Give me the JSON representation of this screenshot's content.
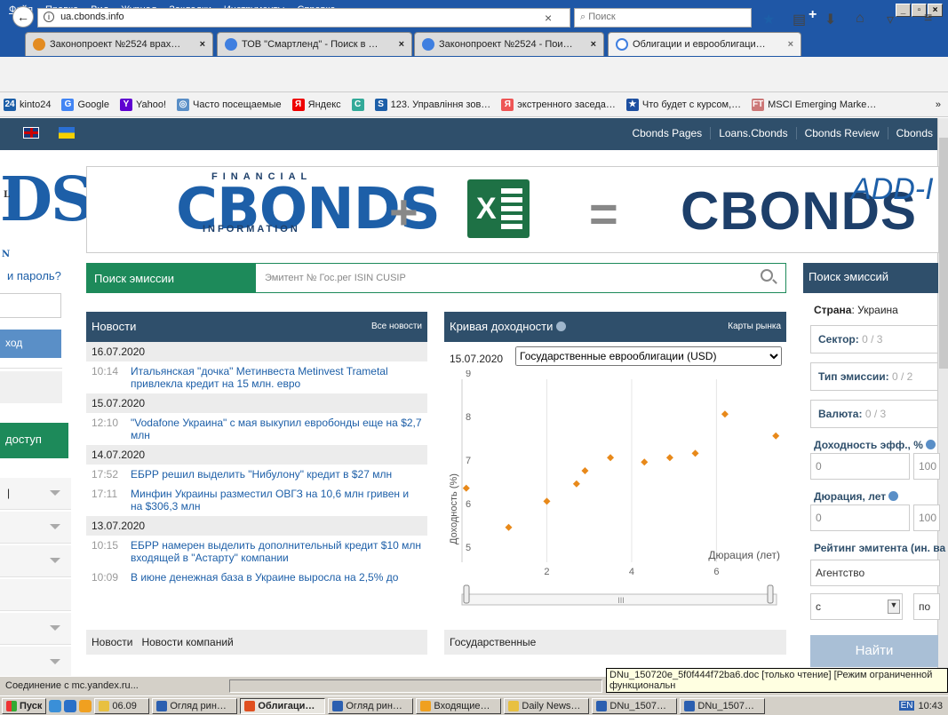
{
  "browser": {
    "menu": [
      "Файл",
      "Правка",
      "Вид",
      "Журнал",
      "Закладки",
      "Инструменты",
      "Справка"
    ],
    "tabs": [
      {
        "label": "Законопроект №2524 врах…",
        "close": "×",
        "color": "#e38b20"
      },
      {
        "label": "ТОВ \"Смартленд\" - Поиск в …",
        "close": "×",
        "color": "#3f7fe0"
      },
      {
        "label": "Законопроект №2524 - Пои…",
        "close": "×",
        "color": "#3f7fe0"
      },
      {
        "label": "Облигации и еврооблигаци…",
        "close": "×",
        "color": "#3f7fe0"
      }
    ],
    "new_tab": "+",
    "url": "ua.cbonds.info",
    "url_clear": "×",
    "search_placeholder": "Поиск",
    "bookmarks": [
      {
        "label": "kinto24",
        "icon": "24",
        "color": "#1d5fa8"
      },
      {
        "label": "Google",
        "icon": "G",
        "color": "#4285f4"
      },
      {
        "label": "Yahoo!",
        "icon": "Y",
        "color": "#5f01d1"
      },
      {
        "label": "Часто посещаемые",
        "icon": "◎",
        "color": "#5a8fc7"
      },
      {
        "label": "Яндекс",
        "icon": "Я",
        "color": "#e00"
      },
      {
        "label": "",
        "icon": "C",
        "color": "#3a9"
      },
      {
        "label": "123. Управління зов…",
        "icon": "S",
        "color": "#1d5fa8"
      },
      {
        "label": "экстренного заседа…",
        "icon": "Я",
        "color": "#e55"
      },
      {
        "label": "Что будет с курсом,…",
        "icon": "★",
        "color": "#1d4fa0"
      },
      {
        "label": "MSCI Emerging Marke…",
        "icon": "FT",
        "color": "#c77"
      }
    ],
    "bookmarks_more": "»"
  },
  "site": {
    "top_links": [
      "Cbonds Pages",
      "Loans.Cbonds",
      "Cbonds Review",
      "Cbonds"
    ],
    "left": {
      "logo": "DS",
      "logo_top": "L",
      "logo_bottom": "N",
      "forgot": "и пароль?",
      "login_btn": "ход",
      "access_btn": "доступ"
    },
    "banner": {
      "logo1": "CBONDS",
      "financial": "FINANCIAL",
      "information": "INFORMATION",
      "plus": "+",
      "excel": "X",
      "equals": "=",
      "logo2": "CBONDS",
      "addin": "ADD-I"
    },
    "search": {
      "label": "Поиск эмиссии",
      "placeholder": "Эмитент № Гос.рег ISIN CUSIP"
    },
    "news": {
      "title": "Новости",
      "all": "Все новости",
      "groups": [
        {
          "date": "16.07.2020",
          "items": [
            {
              "time": "10:14",
              "text": "Итальянская \"дочка\" Метинвеста Metinvest Trametal привлекла кредит на 15 млн. евро"
            }
          ]
        },
        {
          "date": "15.07.2020",
          "items": [
            {
              "time": "12:10",
              "text": "\"Vodafone Украина\" с мая выкупил евробонды еще на $2,7 млн"
            }
          ]
        },
        {
          "date": "14.07.2020",
          "items": [
            {
              "time": "17:52",
              "text": "ЕБРР решил выделить \"Нибулону\" кредит в $27 млн"
            },
            {
              "time": "17:11",
              "text": "Минфин Украины разместил ОВГЗ на 10,6 млн гривен и на $306,3 млн"
            }
          ]
        },
        {
          "date": "13.07.2020",
          "items": [
            {
              "time": "10:15",
              "text": "ЕБРР намерен выделить дополнительный кредит $10 млн входящей в \"Астарту\" компании"
            },
            {
              "time": "10:09",
              "text": "В июне денежная база в Украине выросла на 2,5% до"
            }
          ]
        }
      ],
      "footer": [
        "Новости",
        "Новости компаний"
      ]
    },
    "yield": {
      "title": "Кривая доходности",
      "maps": "Карты рынка",
      "date": "15.07.2020",
      "select": "Государственные еврооблигации (USD)",
      "footer": "Государственные",
      "scroll_mid": "III"
    },
    "filters": {
      "title": "Поиск эмиссий",
      "country_label": "Страна",
      "country_value": ": Украина",
      "sector": "Сектор:",
      "sector_v": "0 / 3",
      "type": "Тип эмиссии:",
      "type_v": "0 / 2",
      "currency": "Валюта:",
      "currency_v": "0 / 3",
      "yield_lbl": "Доходность эфф., %",
      "yield_from": "0",
      "yield_to": "100",
      "dur_lbl": "Дюрация, лет",
      "dur_from": "0",
      "dur_to": "100",
      "rating_lbl": "Рейтинг эмитента (ин. ва",
      "agency": "Агентство",
      "from": "с",
      "to": "по",
      "find": "Найти"
    }
  },
  "status": {
    "text": "Соединение с mc.yandex.ru...",
    "tooltip": "DNu_150720e_5f0f444f72ba6.doc [только чтение] [Режим ограниченной функциональн"
  },
  "taskbar": {
    "start": "Пуск",
    "items": [
      {
        "label": "06.09",
        "color": "#e8c040",
        "active": false
      },
      {
        "label": "Огляд рин…",
        "color": "#2b5fb0",
        "active": false
      },
      {
        "label": "Облигаци…",
        "color": "#e05020",
        "active": true
      },
      {
        "label": "Огляд рин…",
        "color": "#2b5fb0",
        "active": false
      },
      {
        "label": "Входящие…",
        "color": "#f0a020",
        "active": false
      },
      {
        "label": "Daily News…",
        "color": "#e8c040",
        "active": false
      },
      {
        "label": "DNu_1507…",
        "color": "#2b5fb0",
        "active": false
      },
      {
        "label": "DNu_1507…",
        "color": "#2b5fb0",
        "active": false
      }
    ],
    "lang": "EN",
    "time": "10:43"
  },
  "chart_data": {
    "type": "scatter",
    "xlabel": "Дюрация (лет)",
    "ylabel": "Доходность (%)",
    "xlim": [
      0,
      7.5
    ],
    "ylim": [
      4.8,
      9
    ],
    "xticks": [
      2,
      4,
      6
    ],
    "yticks": [
      5,
      6,
      7,
      8,
      9
    ],
    "color": "#e8891a",
    "points": [
      [
        0.1,
        6.5
      ],
      [
        1.1,
        5.6
      ],
      [
        2.0,
        6.2
      ],
      [
        2.7,
        6.6
      ],
      [
        2.9,
        6.9
      ],
      [
        3.5,
        7.2
      ],
      [
        4.3,
        7.1
      ],
      [
        4.9,
        7.2
      ],
      [
        5.5,
        7.3
      ],
      [
        6.2,
        8.2
      ],
      [
        7.4,
        7.7
      ]
    ]
  }
}
